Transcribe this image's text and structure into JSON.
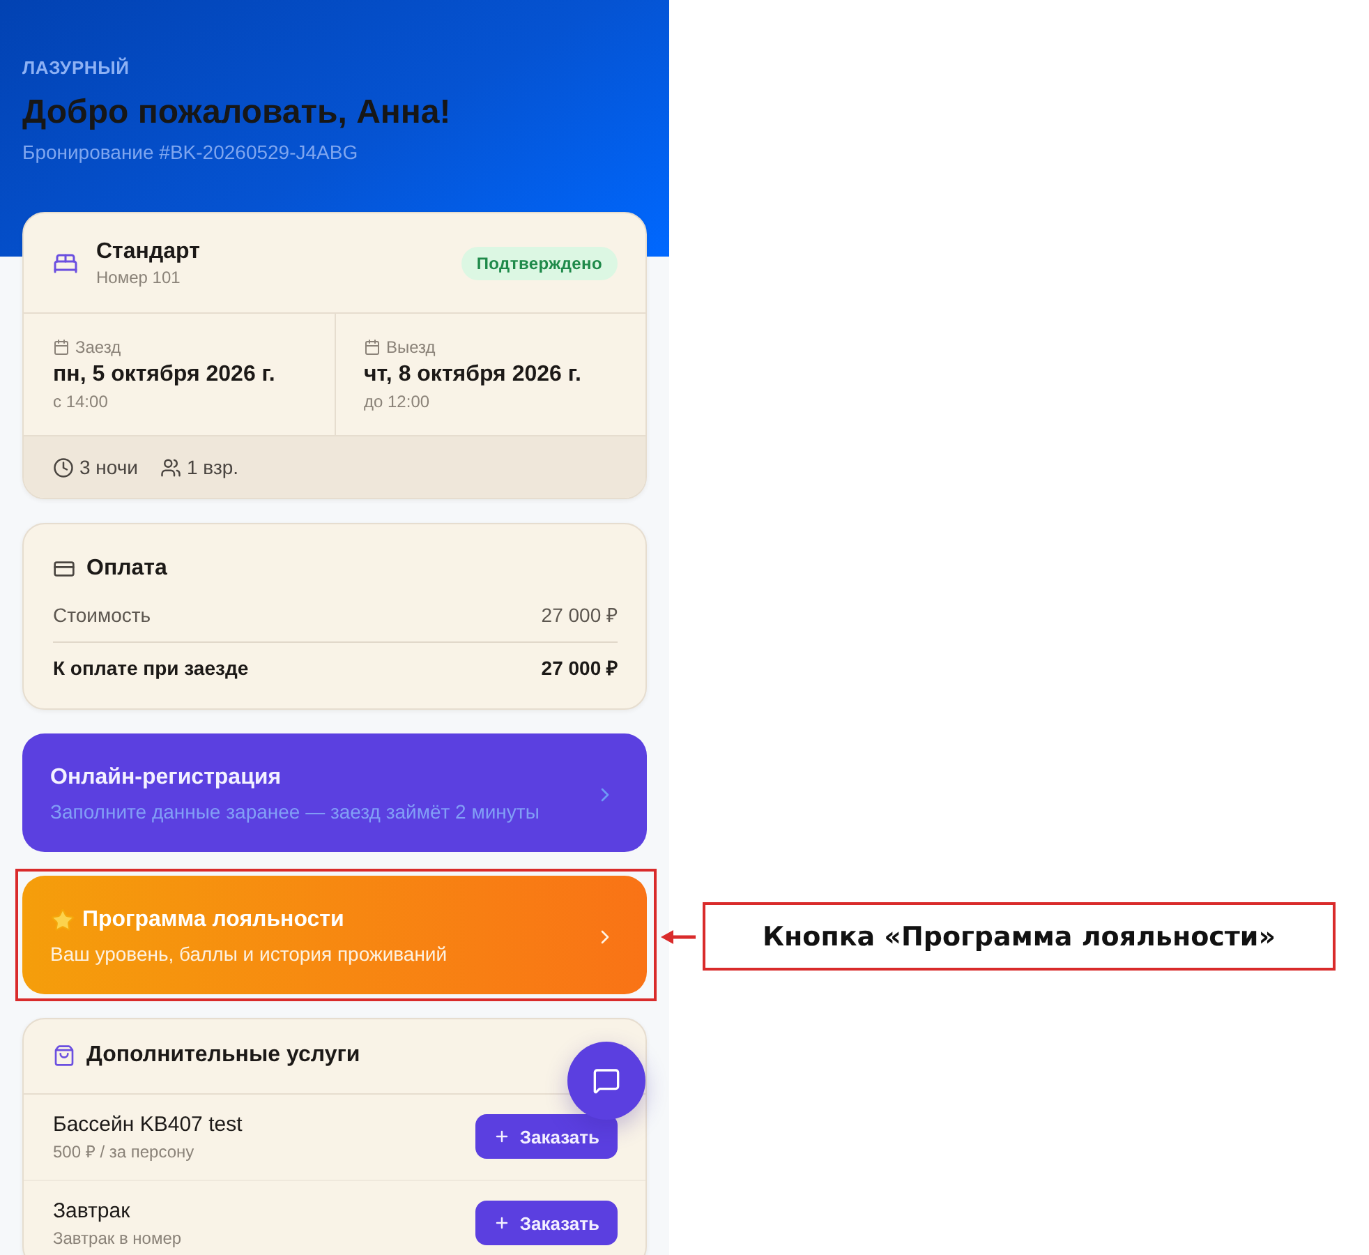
{
  "header": {
    "brand": "ЛАЗУРНЫЙ",
    "greeting": "Добро пожаловать, Анна!",
    "booking_ref": "Бронирование #BK-20260529-J4ABG"
  },
  "room": {
    "name": "Стандарт",
    "number": "Номер 101",
    "status": "Подтверждено"
  },
  "stay": [
    {
      "label": "Заезд",
      "date": "пн, 5 октября 2026 г.",
      "time": "с 14:00"
    },
    {
      "label": "Выезд",
      "date": "чт, 8 октября 2026 г.",
      "time": "до 12:00"
    }
  ],
  "summary": [
    {
      "kind": "nights",
      "text": "3 ночи"
    },
    {
      "kind": "guests",
      "text": "1 взр."
    }
  ],
  "payment": {
    "title": "Оплата",
    "rows": [
      {
        "kind": "line",
        "label": "Стоимость",
        "value": "27 000 ₽"
      },
      {
        "kind": "total",
        "label": "К оплате при заезде",
        "value": "27 000 ₽"
      }
    ]
  },
  "banners": [
    {
      "kind": "checkin",
      "title": "Онлайн-регистрация",
      "subtitle": "Заполните данные заранее — заезд займёт 2 минуты",
      "highlighted": false
    },
    {
      "kind": "loyalty",
      "title": "Программа лояльности",
      "subtitle": "Ваш уровень, баллы и история проживаний",
      "highlighted": true
    }
  ],
  "annotation": {
    "label": "Кнопка «Программа лояльности»"
  },
  "services": {
    "title": "Дополнительные услуги",
    "items": [
      {
        "name": "Бассейн KB407 test",
        "detail": "500 ₽ / за персону",
        "action": "Заказать"
      },
      {
        "name": "Завтрак",
        "detail": "Завтрак в номер",
        "action": "Заказать"
      }
    ]
  }
}
